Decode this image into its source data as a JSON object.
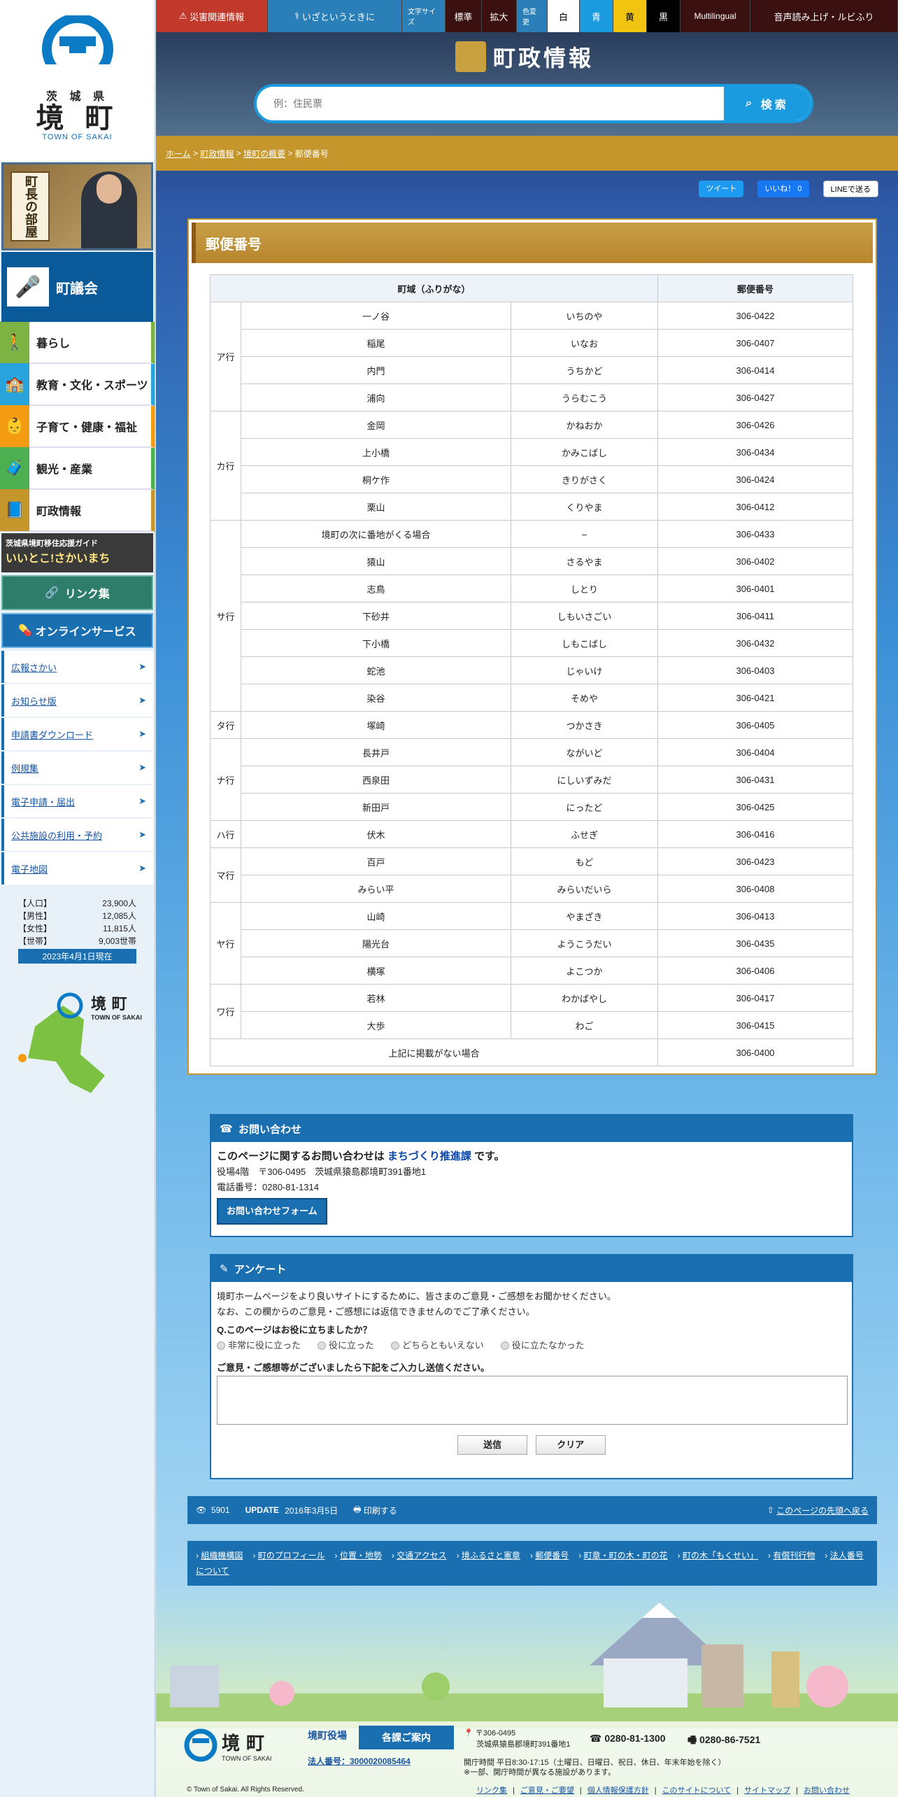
{
  "sidebar": {
    "pref": "茨 城 県",
    "town": "境 町",
    "town_en": "TOWN OF SAKAI",
    "mayor_label": "町長の部屋",
    "council_label": "町議会",
    "nav": [
      {
        "label": "暮らし",
        "color": "#7cb342"
      },
      {
        "label": "教育・文化・スポーツ",
        "color": "#29a3dc"
      },
      {
        "label": "子育て・健康・福祉",
        "color": "#f39c12"
      },
      {
        "label": "観光・産業",
        "color": "#4caf50"
      },
      {
        "label": "町政情報",
        "color": "#c4962b"
      }
    ],
    "guide_small": "茨城県境町移住応援ガイド",
    "guide_big": "いいとこ!さかいまち",
    "link_label": "リンク集",
    "online_label": "オンラインサービス",
    "sublinks": [
      "広報さかい",
      "お知らせ版",
      "申請書ダウンロード",
      "例規集",
      "電子申請・届出",
      "公共施設の利用・予約",
      "電子地図"
    ],
    "population": [
      {
        "label": "【人口】",
        "value": "23,900人"
      },
      {
        "label": "【男性】",
        "value": "12,085人"
      },
      {
        "label": "【女性】",
        "value": "11,815人"
      },
      {
        "label": "【世帯】",
        "value": "9,003世帯"
      }
    ],
    "pop_date": "2023年4月1日現在",
    "map_town": "境 町",
    "map_en": "TOWN OF SAKAI"
  },
  "topbar": {
    "disaster": "災害関連情報",
    "emergency": "いざというときに",
    "textsize_label": "文字サイズ",
    "standard": "標準",
    "enlarge": "拡大",
    "color_label": "色変更",
    "white": "白",
    "blue": "青",
    "yellow": "黄",
    "black": "黒",
    "multilingual": "Multilingual",
    "readout": "音声読み上げ・ルビふり"
  },
  "header": {
    "title": "町政情報",
    "search_placeholder": "例：住民票",
    "search_btn": "検索"
  },
  "breadcrumb": [
    "ホーム",
    "町政情報",
    "境町の概要",
    "郵便番号"
  ],
  "share": {
    "tweet": "ツイート",
    "like": "いいね！ 0",
    "line": "LINEで送る"
  },
  "page": {
    "title": "郵便番号",
    "col_area": "町域（ふりがな）",
    "col_zip": "郵便番号",
    "rows": [
      {
        "group": "ア行",
        "span": 4,
        "area": "一ノ谷",
        "kana": "いちのや",
        "zip": "306-0422"
      },
      {
        "area": "稲尾",
        "kana": "いなお",
        "zip": "306-0407"
      },
      {
        "area": "内門",
        "kana": "うちかど",
        "zip": "306-0414"
      },
      {
        "area": "浦向",
        "kana": "うらむこう",
        "zip": "306-0427"
      },
      {
        "group": "カ行",
        "span": 4,
        "area": "金岡",
        "kana": "かねおか",
        "zip": "306-0426"
      },
      {
        "area": "上小橋",
        "kana": "かみこばし",
        "zip": "306-0434"
      },
      {
        "area": "桐ケ作",
        "kana": "きりがさく",
        "zip": "306-0424"
      },
      {
        "area": "栗山",
        "kana": "くりやま",
        "zip": "306-0412"
      },
      {
        "group": "サ行",
        "span": 7,
        "area": "境町の次に番地がくる場合",
        "kana": "–",
        "zip": "306-0433"
      },
      {
        "area": "猿山",
        "kana": "さるやま",
        "zip": "306-0402"
      },
      {
        "area": "志鳥",
        "kana": "しとり",
        "zip": "306-0401"
      },
      {
        "area": "下砂井",
        "kana": "しもいさごい",
        "zip": "306-0411"
      },
      {
        "area": "下小橋",
        "kana": "しもこばし",
        "zip": "306-0432"
      },
      {
        "area": "蛇池",
        "kana": "じゃいけ",
        "zip": "306-0403"
      },
      {
        "area": "染谷",
        "kana": "そめや",
        "zip": "306-0421"
      },
      {
        "group": "タ行",
        "span": 1,
        "area": "塚崎",
        "kana": "つかさき",
        "zip": "306-0405"
      },
      {
        "group": "ナ行",
        "span": 3,
        "area": "長井戸",
        "kana": "ながいど",
        "zip": "306-0404"
      },
      {
        "area": "西泉田",
        "kana": "にしいずみだ",
        "zip": "306-0431"
      },
      {
        "area": "新田戸",
        "kana": "にったど",
        "zip": "306-0425"
      },
      {
        "group": "ハ行",
        "span": 1,
        "area": "伏木",
        "kana": "ふせぎ",
        "zip": "306-0416"
      },
      {
        "group": "マ行",
        "span": 2,
        "area": "百戸",
        "kana": "もど",
        "zip": "306-0423"
      },
      {
        "area": "みらい平",
        "kana": "みらいだいら",
        "zip": "306-0408"
      },
      {
        "group": "ヤ行",
        "span": 3,
        "area": "山崎",
        "kana": "やまざき",
        "zip": "306-0413"
      },
      {
        "area": "陽光台",
        "kana": "ようこうだい",
        "zip": "306-0435"
      },
      {
        "area": "横塚",
        "kana": "よこつか",
        "zip": "306-0406"
      },
      {
        "group": "ワ行",
        "span": 2,
        "area": "若林",
        "kana": "わかばやし",
        "zip": "306-0417"
      },
      {
        "area": "大歩",
        "kana": "わご",
        "zip": "306-0415"
      }
    ],
    "other_label": "上記に掲載がない場合",
    "other_zip": "306-0400"
  },
  "contact": {
    "title": "お問い合わせ",
    "lead_pre": "このページに関するお問い合わせは",
    "dept": "まちづくり推進課",
    "lead_post": "です。",
    "address": "役場4階　〒306-0495　茨城県猿島郡境町391番地1",
    "phone": "電話番号：0280-81-1314",
    "form_btn": "お問い合わせフォーム"
  },
  "survey": {
    "title": "アンケート",
    "intro1": "境町ホームページをより良いサイトにするために、皆さまのご意見・ご感想をお聞かせください。",
    "intro2": "なお、この欄からのご意見・ご感想には返信できませんのでご了承ください。",
    "question": "Q.このページはお役に立ちましたか？",
    "options": [
      "非常に役に立った",
      "役に立った",
      "どちらともいえない",
      "役に立たなかった"
    ],
    "comment_label": "ご意見・ご感想等がございましたら下記をご入力し送信ください。",
    "send": "送信",
    "clear": "クリア"
  },
  "infobar": {
    "views": "5901",
    "update_label": "UPDATE",
    "update_date": "2016年3月5日",
    "print": "印刷する",
    "totop": "このページの先頭へ戻る"
  },
  "footnav": [
    "組織機構図",
    "町のプロフィール",
    "位置・地勢",
    "交通アクセス",
    "境ふるさと憲章",
    "郵便番号",
    "町章・町の木・町の花",
    "町の木「もくせい」",
    "有償刊行物",
    "法人番号について"
  ],
  "footer": {
    "town": "境 町",
    "town_en": "TOWN OF SAKAI",
    "office": "境町役場",
    "guide": "各課ご案内",
    "corp_no": "法人番号：3000020085464",
    "zip": "〒306-0495",
    "addr": "茨城県猿島郡境町391番地1",
    "tel": "0280-81-1300",
    "fax": "0280-86-7521",
    "hours1": "開庁時間 平日8:30-17:15（土曜日、日曜日、祝日、休日、年末年始を除く）",
    "hours2": "※一部、開庁時間が異なる施設があります。",
    "copyright": "© Town of Sakai. All Rights Reserved.",
    "links": [
      "リンク集",
      "ご意見・ご要望",
      "個人情報保護方針",
      "このサイトについて",
      "サイトマップ",
      "お問い合わせ"
    ]
  }
}
